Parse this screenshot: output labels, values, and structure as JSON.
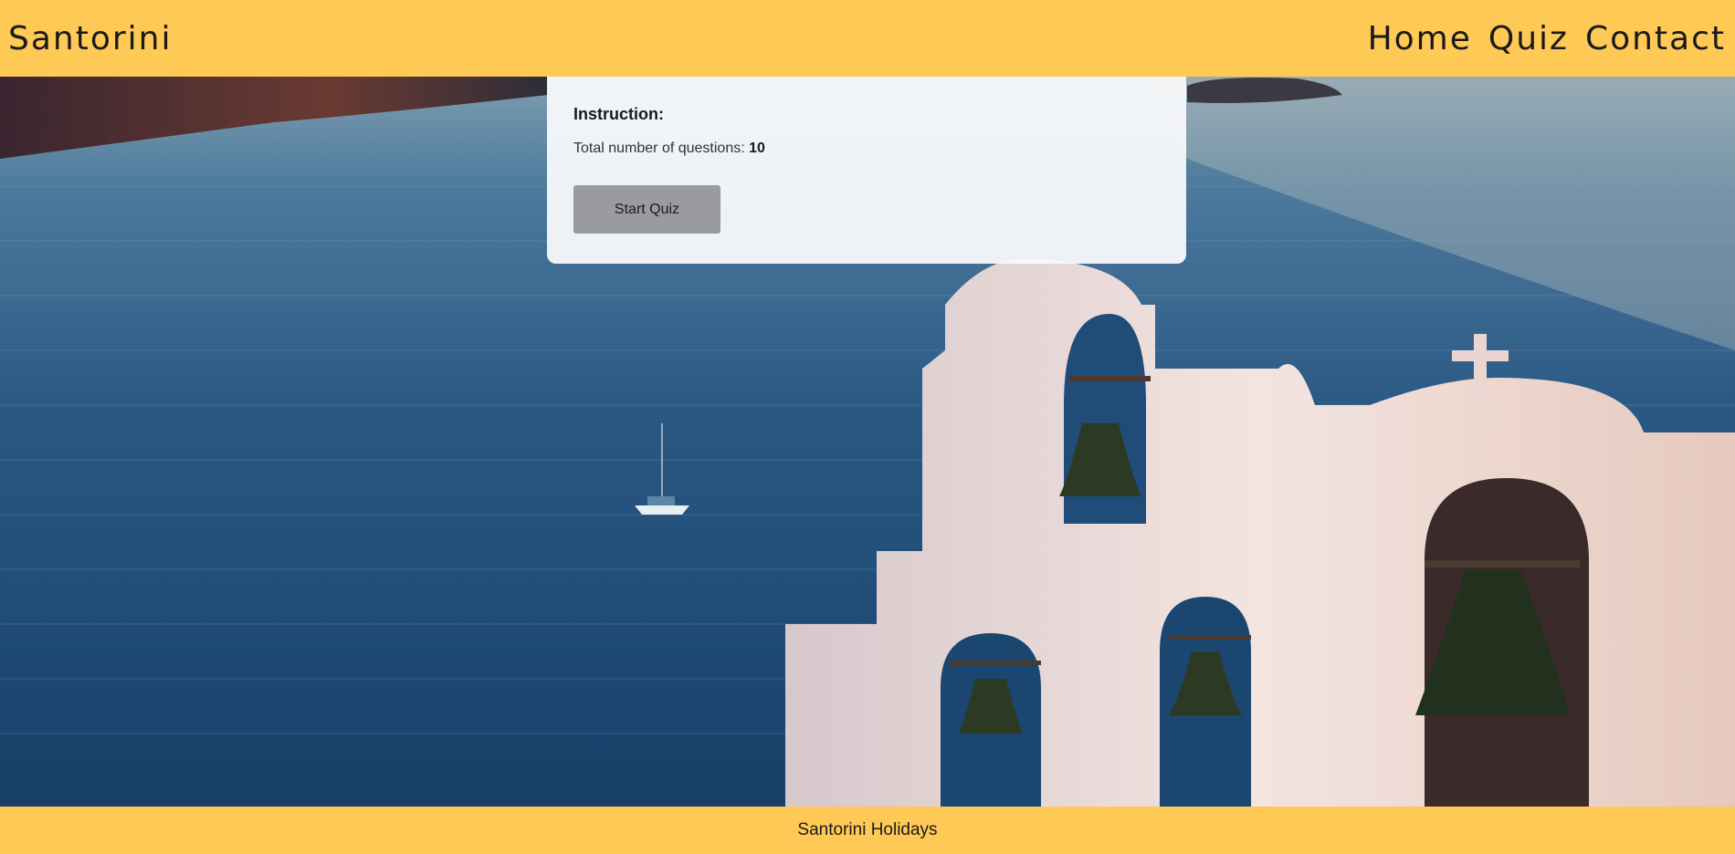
{
  "header": {
    "brand": "Santorini",
    "nav": [
      "Home",
      "Quiz",
      "Contact"
    ]
  },
  "card": {
    "title": "Instruction:",
    "total_label": "Total number of questions:",
    "total_value": "10",
    "start_label": "Start Quiz"
  },
  "footer": {
    "text": "Santorini Holidays"
  },
  "colors": {
    "header_bg": "#ffc955",
    "footer_bg": "#ffc955",
    "button_bg": "#999b9e",
    "sea": "#1f4c79"
  }
}
